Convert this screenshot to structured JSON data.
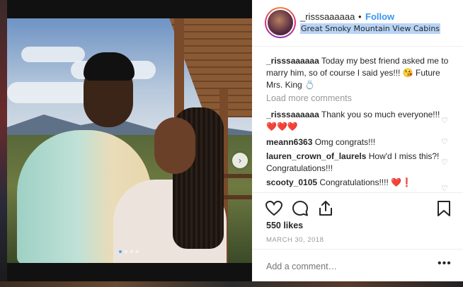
{
  "post": {
    "username": "_risssaaaaaa",
    "bullet": "•",
    "follow_label": "Follow",
    "location": "Great Smoky Mountain View Cabins",
    "caption_user": "_risssaaaaaa",
    "caption_text": "Today my best friend asked me to marry him, so of course I said yes!!! 😘 Future Mrs. King 💍",
    "load_more_label": "Load more comments",
    "comments": [
      {
        "user": "_risssaaaaaa",
        "text": "Thank you so much everyone!!! ❤️❤️❤️"
      },
      {
        "user": "meann6363",
        "text": "Omg congrats!!!"
      },
      {
        "user": "lauren_crown_of_laurels",
        "text": "How'd I miss this?! Congratulations!!!"
      },
      {
        "user": "scooty_0105",
        "text": "Congratulations!!!! ❤️❗"
      }
    ],
    "likes": "550 likes",
    "date": "MARCH 30, 2018",
    "add_comment_placeholder": "Add a comment…",
    "more_label": "•••",
    "next_label": "›"
  },
  "icons": {
    "like": "heart-outline-icon",
    "comment": "speech-bubble-icon",
    "share": "share-arrow-icon",
    "save": "bookmark-icon",
    "comment_like": "small-heart-icon"
  },
  "colors": {
    "follow": "#3897f0",
    "text": "#262626",
    "muted": "#999999",
    "selection": "#b8d4f6"
  }
}
